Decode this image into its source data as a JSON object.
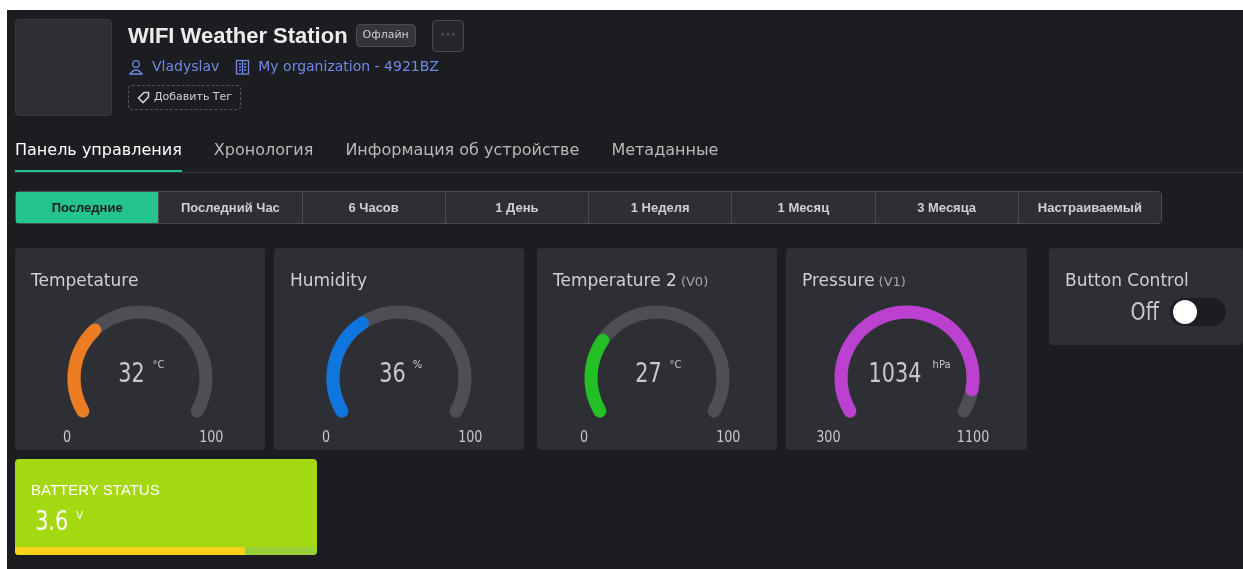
{
  "device": {
    "title": "WIFI Weather Station",
    "status": "Офлайн",
    "more": "◦◦◦",
    "owner": "Vladyslav",
    "organization": "My organization - 4921BZ",
    "add_tag": "Добавить Тег"
  },
  "tabs": [
    {
      "label": "Панель управления",
      "selected": true
    },
    {
      "label": "Хронология",
      "selected": false
    },
    {
      "label": "Информация об устройстве",
      "selected": false
    },
    {
      "label": "Метаданные",
      "selected": false
    }
  ],
  "time_ranges": [
    {
      "label": "Последние",
      "selected": true
    },
    {
      "label": "Последний Час",
      "selected": false
    },
    {
      "label": "6 Часов",
      "selected": false
    },
    {
      "label": "1 День",
      "selected": false
    },
    {
      "label": "1 Неделя",
      "selected": false
    },
    {
      "label": "1 Месяц",
      "selected": false
    },
    {
      "label": "3 Месяца",
      "selected": false
    },
    {
      "label": "Настраиваемый",
      "selected": false
    }
  ],
  "widgets": [
    {
      "kind": "gauge",
      "title": "Tempetature",
      "value": "32",
      "unit": "°C",
      "min": "0",
      "max": "100",
      "color": "#ec7c22"
    },
    {
      "kind": "gauge",
      "title": "Humidity",
      "value": "36",
      "unit": "%",
      "min": "0",
      "max": "100",
      "color": "#0f76e0"
    },
    {
      "kind": "gauge",
      "title": "Temperature 2",
      "pin": "(V0)",
      "value": "27",
      "unit": "°C",
      "min": "0",
      "max": "100",
      "color": "#22bf25"
    },
    {
      "kind": "gauge",
      "title": "Pressure",
      "pin": "(V1)",
      "value": "1034",
      "unit": "hPa",
      "min": "300",
      "max": "1100",
      "color": "#bd41d1"
    },
    {
      "kind": "switch",
      "title": "Button Control",
      "state_label": "Off",
      "on": false
    }
  ],
  "battery": {
    "title": "BATTERY STATUS",
    "value": "3.6",
    "unit": "V",
    "level": 0.76
  }
}
